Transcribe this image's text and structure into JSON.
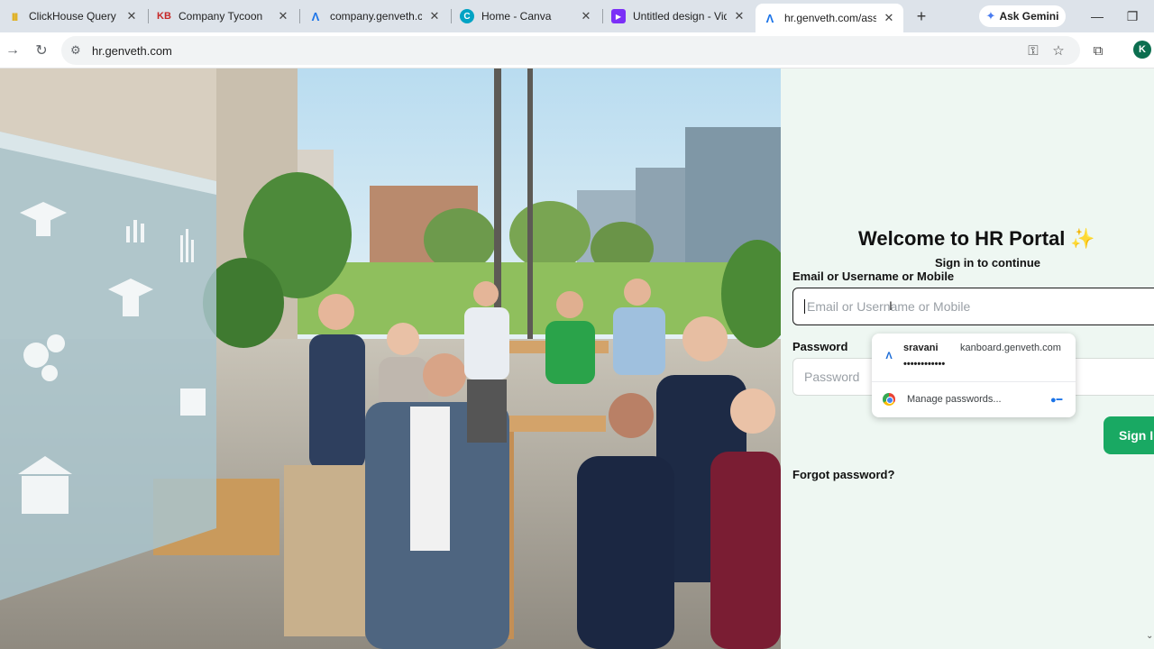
{
  "browser": {
    "tabs": [
      {
        "title": "ClickHouse Query",
        "favicon": "clickhouse-icon",
        "favicon_text": "||||",
        "favicon_color": "#f5c518"
      },
      {
        "title": "Company Tycoon",
        "favicon": "kb-icon",
        "favicon_text": "KB",
        "favicon_color": "#c62828"
      },
      {
        "title": "company.genveth.com",
        "favicon": "genveth-icon",
        "favicon_text": "Λ",
        "favicon_color": "#1a73e8"
      },
      {
        "title": "Home - Canva",
        "favicon": "canva-icon",
        "favicon_text": "C",
        "favicon_color": "#00c4cc"
      },
      {
        "title": "Untitled design - Vide",
        "favicon": "video-icon",
        "favicon_text": "▶",
        "favicon_color": "#7b2ff7"
      },
      {
        "title": "hr.genveth.com/asses",
        "favicon": "genveth-icon",
        "favicon_text": "Λ",
        "favicon_color": "#1a73e8"
      }
    ],
    "new_tab_glyph": "+",
    "gemini_label": "Ask Gemini",
    "address": "hr.genveth.com",
    "profile_initial": "K"
  },
  "login": {
    "title": "Welcome to HR Portal",
    "title_emoji": "✨",
    "subtitle": "Sign in to continue",
    "email_label": "Email or Username or Mobile",
    "email_placeholder": "Email or Username or Mobile",
    "password_label": "Password",
    "password_placeholder": "Password",
    "signin_label": "Sign In",
    "forgot_label": "Forgot password?"
  },
  "password_popup": {
    "username": "sravani",
    "site": "kanboard.genveth.com",
    "masked_password": "••••••••••••",
    "manage_label": "Manage passwords..."
  },
  "colors": {
    "panel_bg": "#eef7f2",
    "accent_green": "#19a963",
    "tab_strip": "#dde3ea"
  }
}
